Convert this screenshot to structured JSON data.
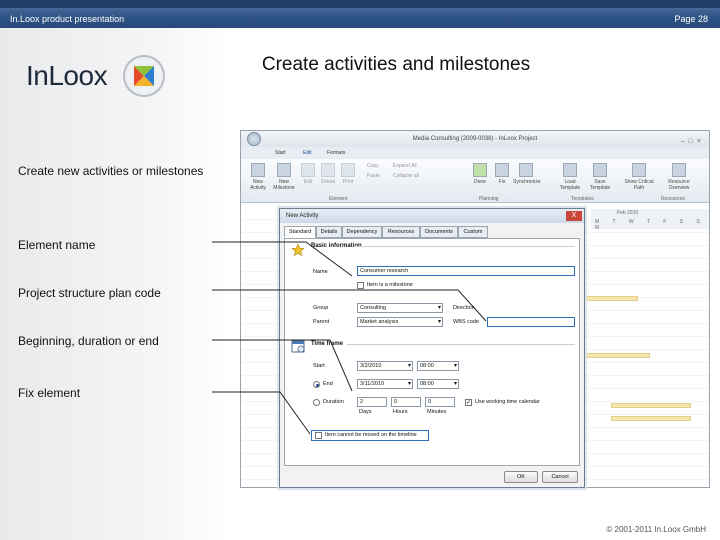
{
  "header": {
    "left_text": "In.Loox product presentation",
    "right_text": "Page 28"
  },
  "logo": {
    "text": "InLoox"
  },
  "slide_title": "Create activities and milestones",
  "labels": [
    "Create new activities or milestones",
    "Element name",
    "Project structure plan code",
    "Beginning, duration or end",
    "Fix element"
  ],
  "footer": "© 2001-2011 In.Loox GmbH",
  "app": {
    "window_title": "Media Consulting (2009-0038) - InLoox Project",
    "tabs": [
      "Start",
      "Edit",
      "Formats"
    ],
    "ribbon": {
      "buttons": [
        "New Activity",
        "New Milestone",
        "Edit",
        "Delete",
        "Print"
      ],
      "small_items": [
        "Copy",
        "Paste",
        "Expand All",
        "Collapse all"
      ],
      "right_buttons": [
        "Done",
        "Fix",
        "Synchronize",
        "Load Template",
        "Save Template",
        "Show Critical Path",
        "Resource Overview"
      ],
      "groups": [
        "Element",
        "Planning",
        "Templates",
        "Resources"
      ]
    },
    "gantt_month": "Feb 2010",
    "gantt_days": "M T W T F S S M"
  },
  "dialog": {
    "title": "New Activity",
    "close_label": "X",
    "tabs": [
      "Standard",
      "Details",
      "Dependency",
      "Resources",
      "Documents",
      "Custom"
    ],
    "basic_section": "Basic information",
    "name_label": "Name",
    "name_value": "Consumer research",
    "milestone_label": "Item is a milestone",
    "group_label": "Group",
    "group_value": "Consulting",
    "parent_label": "Parent",
    "parent_value": "Market analysis",
    "direction_label": "Direction",
    "wbs_label": "WBS code",
    "wbs_value": "",
    "timeframe_section": "Time frame",
    "start_label": "Start",
    "start_date": "3/2/2010",
    "start_time": "08:00",
    "end_label": "End",
    "end_date": "3/11/2010",
    "end_time": "08:00",
    "duration_label": "Duration",
    "duration_days": "2",
    "duration_hours": "0",
    "duration_minutes": "0",
    "days_label": "Days",
    "hours_label": "Hours",
    "minutes_label": "Minutes",
    "working_calendar_label": "Use working time calendar",
    "fix_label": "Item cannot be moved on the timeline",
    "ok_label": "OK",
    "cancel_label": "Cancel"
  },
  "colors": {
    "header_bar": "#2f5586",
    "highlight": "#2f6fb5",
    "logo_x_colors": [
      "#e34b2a",
      "#8fc23b",
      "#2b7fd1",
      "#f4b12a"
    ]
  }
}
